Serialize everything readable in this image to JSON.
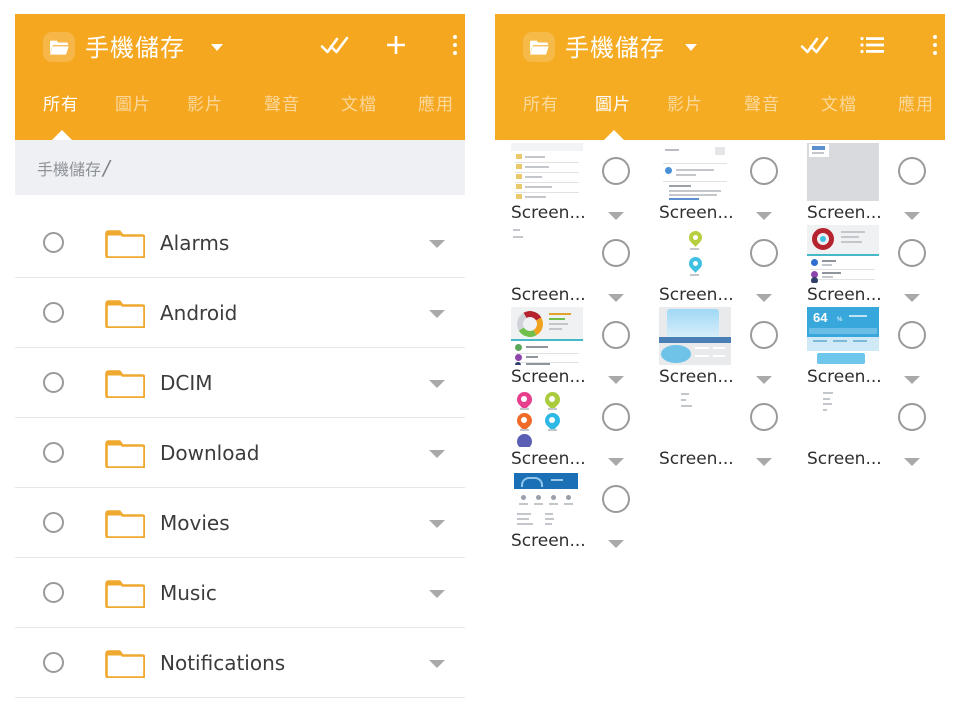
{
  "app": {
    "accent_color": "#f5a720",
    "header_color_left": "#f5a720",
    "header_color_right": "#f5ab22",
    "breadcrumb_bg": "#eef0f3",
    "folder_icon_color": "#f1a92c",
    "title": "手機儲存",
    "folder_icon": "folder-icon",
    "title_caret_icon": "chevron-down-icon"
  },
  "left_panel": {
    "toolbar": {
      "select_all_label": "select-all-icon",
      "add_label": "plus-icon",
      "overflow_label": "more-vertical-icon"
    },
    "tabs": [
      {
        "label": "所有",
        "active": true
      },
      {
        "label": "圖片",
        "active": false
      },
      {
        "label": "影片",
        "active": false
      },
      {
        "label": "聲音",
        "active": false
      },
      {
        "label": "文檔",
        "active": false
      },
      {
        "label": "應用",
        "active": false
      }
    ],
    "breadcrumb": {
      "root": "手機儲存",
      "separator": "/"
    },
    "files": [
      {
        "name": "Alarms",
        "type": "folder"
      },
      {
        "name": "Android",
        "type": "folder"
      },
      {
        "name": "DCIM",
        "type": "folder"
      },
      {
        "name": "Download",
        "type": "folder"
      },
      {
        "name": "Movies",
        "type": "folder"
      },
      {
        "name": "Music",
        "type": "folder"
      },
      {
        "name": "Notifications",
        "type": "folder"
      }
    ]
  },
  "right_panel": {
    "toolbar": {
      "select_all_label": "select-all-icon",
      "view_mode_label": "list-view-icon",
      "overflow_label": "more-vertical-icon"
    },
    "tabs": [
      {
        "label": "所有",
        "active": false
      },
      {
        "label": "圖片",
        "active": true
      },
      {
        "label": "影片",
        "active": false
      },
      {
        "label": "聲音",
        "active": false
      },
      {
        "label": "文檔",
        "active": false
      },
      {
        "label": "應用",
        "active": false
      }
    ],
    "grid_items": [
      {
        "label": "Screen...",
        "thumb": "filelist"
      },
      {
        "label": "Screen...",
        "thumb": "document"
      },
      {
        "label": "Screen...",
        "thumb": "blank-gray"
      },
      {
        "label": "Screen...",
        "thumb": "sparse-text"
      },
      {
        "label": "Screen...",
        "thumb": "two-pins"
      },
      {
        "label": "Screen...",
        "thumb": "donut-red"
      },
      {
        "label": "Screen...",
        "thumb": "donut-multi"
      },
      {
        "label": "Screen...",
        "thumb": "blue-chart"
      },
      {
        "label": "Screen...",
        "thumb": "weather-64"
      },
      {
        "label": "Screen...",
        "thumb": "app-pins"
      },
      {
        "label": "Screen...",
        "thumb": "tiny-lines"
      },
      {
        "label": "Screen...",
        "thumb": "tiny-lines2"
      },
      {
        "label": "Screen...",
        "thumb": "blue-header"
      }
    ],
    "weather_value": "64"
  }
}
